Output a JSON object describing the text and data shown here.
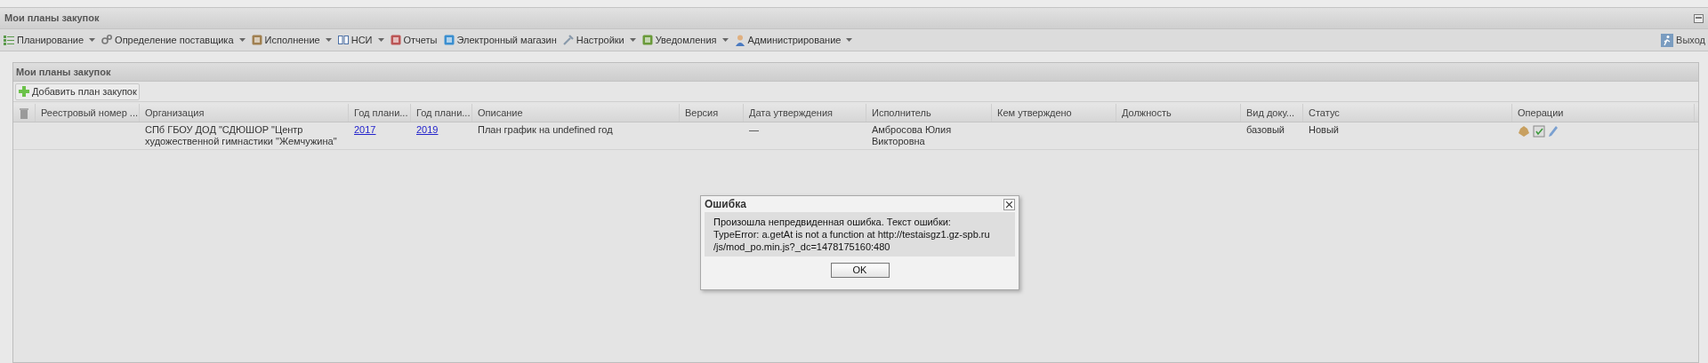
{
  "window": {
    "title": "Мои планы закупок"
  },
  "menu": [
    {
      "label": "Планирование",
      "dropdown": true
    },
    {
      "label": "Определение поставщика",
      "dropdown": true
    },
    {
      "label": "Исполнение",
      "dropdown": true
    },
    {
      "label": "НСИ",
      "dropdown": true
    },
    {
      "label": "Отчеты",
      "dropdown": false
    },
    {
      "label": "Электронный магазин",
      "dropdown": false
    },
    {
      "label": "Настройки",
      "dropdown": true
    },
    {
      "label": "Уведомления",
      "dropdown": true
    },
    {
      "label": "Администрирование",
      "dropdown": true
    }
  ],
  "exit": {
    "label": "Выход"
  },
  "panel": {
    "title": "Мои планы закупок",
    "add_button": "Добавить план закупок"
  },
  "table": {
    "columns": [
      "Реестровый номер ...",
      "Организация",
      "Год плани...",
      "Год плани...",
      "Описание",
      "Версия",
      "Дата утверждения",
      "Исполнитель",
      "Кем утверждено",
      "Должность",
      "Вид доку...",
      "Статус",
      "Операции"
    ],
    "rows": [
      {
        "cells": [
          {
            "kind": "text",
            "text": ""
          },
          {
            "kind": "text",
            "text": "СПб ГБОУ ДОД \"СДЮШОР \"Центр художественной гимнастики \"Жемчужина\""
          },
          {
            "kind": "link",
            "text": "2017"
          },
          {
            "kind": "link",
            "text": "2019"
          },
          {
            "kind": "text",
            "text": "План график на undefined год"
          },
          {
            "kind": "text",
            "text": ""
          },
          {
            "kind": "text",
            "text": "—"
          },
          {
            "kind": "text",
            "text": "Амбросова Юлия Викторовна"
          },
          {
            "kind": "text",
            "text": ""
          },
          {
            "kind": "text",
            "text": ""
          },
          {
            "kind": "text",
            "text": "базовый"
          },
          {
            "kind": "text",
            "text": "Новый"
          },
          {
            "kind": "actions"
          }
        ]
      }
    ]
  },
  "dialog": {
    "title": "Ошибка",
    "message": [
      "Произошла непредвиденная ошибка. Текст ошибки:",
      "TypeError: a.getAt is not a function at http://testaisgz1.gz-spb.ru",
      "/js/mod_po.min.js?_dc=1478175160:480"
    ],
    "button": "OK"
  }
}
